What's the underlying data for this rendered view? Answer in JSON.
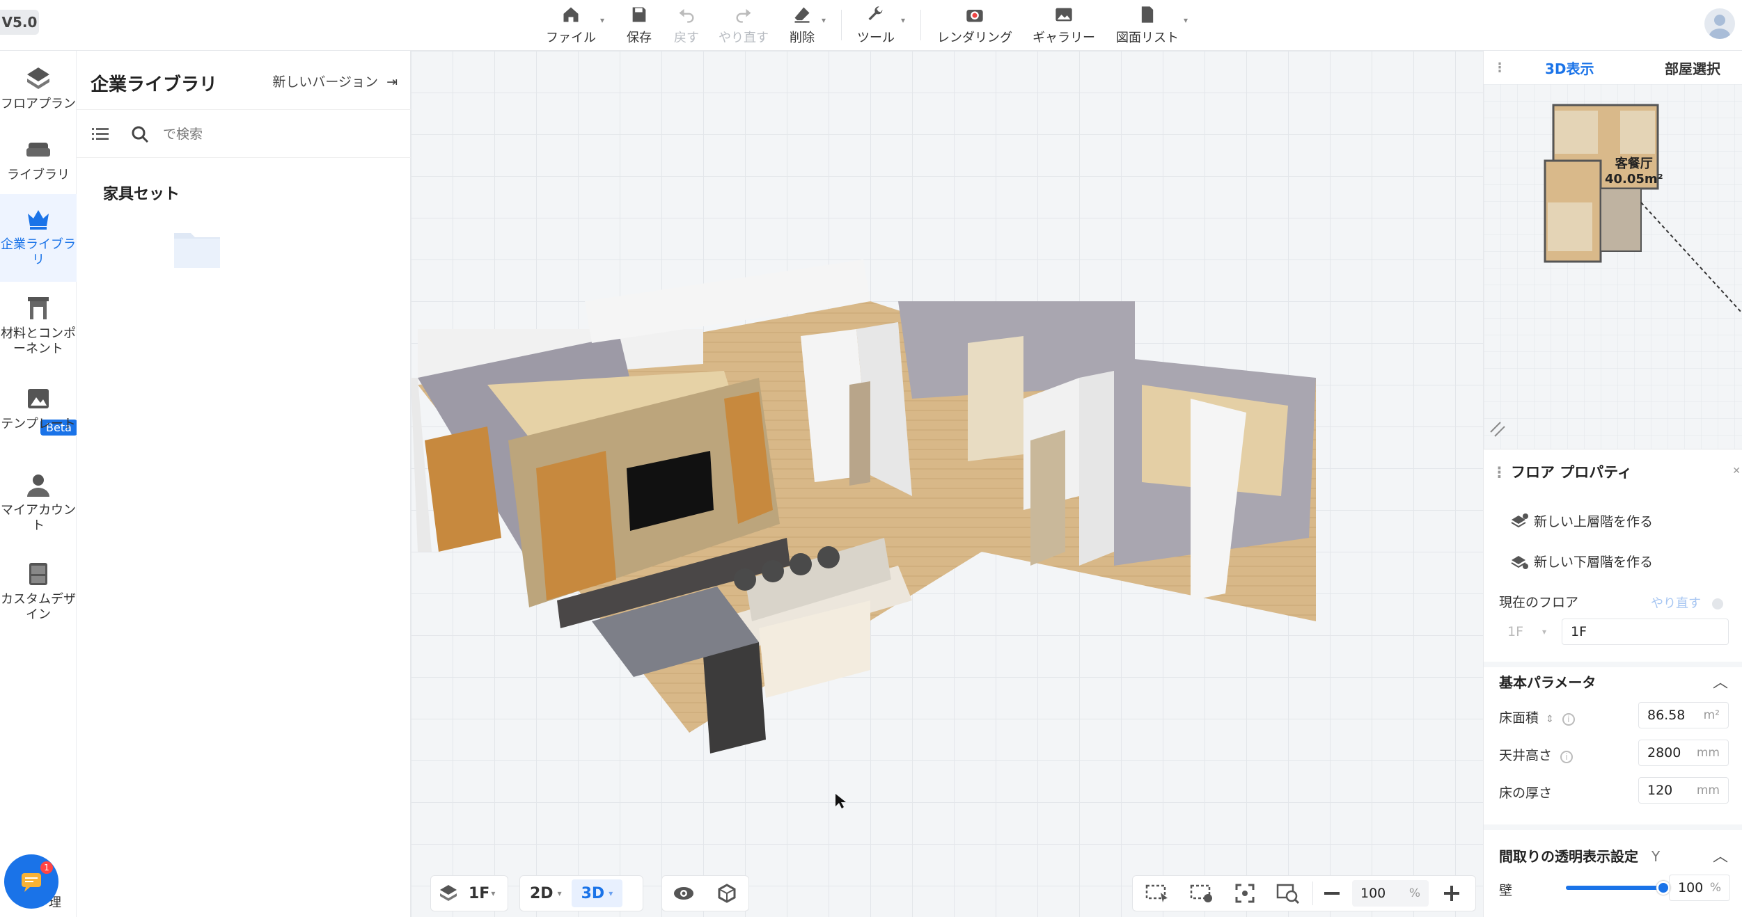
{
  "app": {
    "version": "V5.0"
  },
  "toolbar": {
    "file": "ファイル",
    "save": "保存",
    "undo": "戻す",
    "redo": "やり直す",
    "delete": "削除",
    "tools": "ツール",
    "rendering": "レンダリング",
    "gallery": "ギャラリー",
    "drawing_list": "図面リスト"
  },
  "sidebar": {
    "items": [
      {
        "label": "フロアプラン",
        "icon": "floorplan-icon"
      },
      {
        "label": "ライブラリ",
        "icon": "sofa-icon"
      },
      {
        "label": "企業ライブラリ",
        "icon": "crown-icon"
      },
      {
        "label": "材料とコンポーネント",
        "icon": "fireplace-icon"
      },
      {
        "label": "テンプレート",
        "icon": "template-icon"
      },
      {
        "label": "マイアカウント",
        "icon": "user-icon"
      },
      {
        "label": "カスタムデザイン",
        "icon": "cabinet-icon"
      }
    ],
    "beta_label": "Beta",
    "bottom_label": "理"
  },
  "library": {
    "title": "企業ライブラリ",
    "new_version": "新しいバージョン",
    "search_placeholder": "で検索",
    "section": "家具セット"
  },
  "bottom": {
    "floor": "1F",
    "view2d": "2D",
    "view3d": "3D",
    "zoom": "100",
    "zoom_unit": "%"
  },
  "right": {
    "tab_3d": "3D表示",
    "tab_room": "部屋選択",
    "room_name": "客餐厅",
    "room_area": "40.05m²",
    "floor_props_title": "フロア プロパティ",
    "new_upper": "新しい上層階を作る",
    "new_lower": "新しい下層階を作る",
    "current_floor": "現在のフロア",
    "redo": "やり直す",
    "floor_code": "1F",
    "floor_value": "1F",
    "basic_params": "基本パラメータ",
    "floor_area_label": "床面積",
    "floor_area": "86.58",
    "floor_area_unit": "m²",
    "ceiling_label": "天井高さ",
    "ceiling": "2800",
    "ceiling_unit": "mm",
    "thickness_label": "床の厚さ",
    "thickness": "120",
    "thickness_unit": "mm",
    "transparency_title": "間取りの透明表示設定",
    "transparency_hint": "Y",
    "wall_label": "壁",
    "wall_value": "100",
    "wall_unit": "%",
    "wall_level": 1.0
  },
  "colors": {
    "accent": "#1a73e8",
    "wood": "#d9b98a",
    "wall": "#f2f2f2"
  }
}
